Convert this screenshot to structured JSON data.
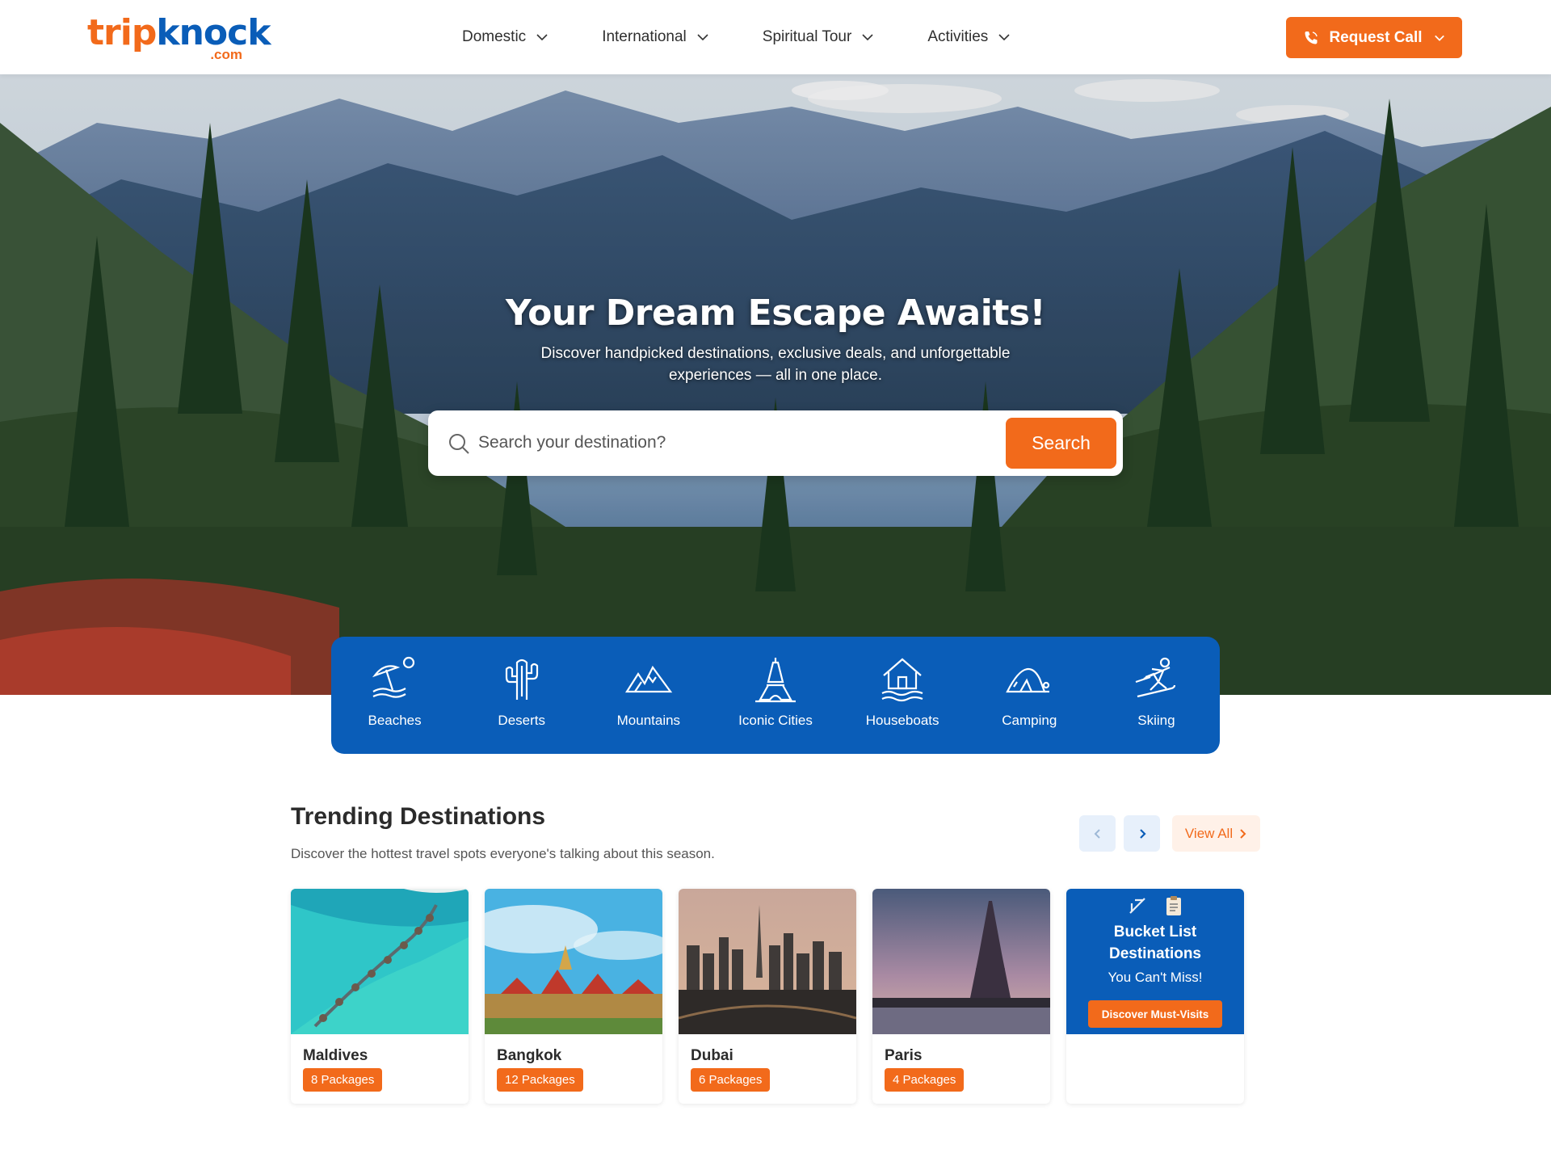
{
  "header": {
    "logo": {
      "main_left": "trip",
      "main_right": "knock",
      "suffix": ".com"
    },
    "nav": [
      {
        "label": "Domestic"
      },
      {
        "label": "International"
      },
      {
        "label": "Spiritual Tour"
      },
      {
        "label": "Activities"
      }
    ],
    "request_call": "Request Call"
  },
  "hero": {
    "title": "Your Dream Escape Awaits!",
    "subtitle": "Discover handpicked destinations, exclusive deals, and unforgettable experiences — all in one place.",
    "search": {
      "placeholder": "Search your destination?",
      "value": "",
      "button": "Search"
    }
  },
  "categories": [
    {
      "label": "Beaches",
      "icon": "beach-umbrella-icon"
    },
    {
      "label": "Deserts",
      "icon": "cactus-icon"
    },
    {
      "label": "Mountains",
      "icon": "mountain-icon"
    },
    {
      "label": "Iconic Cities",
      "icon": "eiffel-tower-icon"
    },
    {
      "label": "Houseboats",
      "icon": "houseboat-icon"
    },
    {
      "label": "Camping",
      "icon": "tent-icon"
    },
    {
      "label": "Skiing",
      "icon": "skier-icon"
    }
  ],
  "trending": {
    "title": "Trending Destinations",
    "subtitle": "Discover the hottest travel spots everyone's talking about this season.",
    "view_all": "View All",
    "destinations": [
      {
        "name": "Maldives",
        "packages": "8 Packages"
      },
      {
        "name": "Bangkok",
        "packages": "12 Packages"
      },
      {
        "name": "Dubai",
        "packages": "6 Packages"
      },
      {
        "name": "Paris",
        "packages": "4 Packages"
      }
    ],
    "bucket": {
      "title_line1": "Bucket List",
      "title_line2": "Destinations",
      "subtitle": "You Can't Miss!",
      "button": "Discover Must-Visits"
    }
  },
  "colors": {
    "accent": "#f26a1b",
    "brand_blue": "#0a5db8"
  }
}
